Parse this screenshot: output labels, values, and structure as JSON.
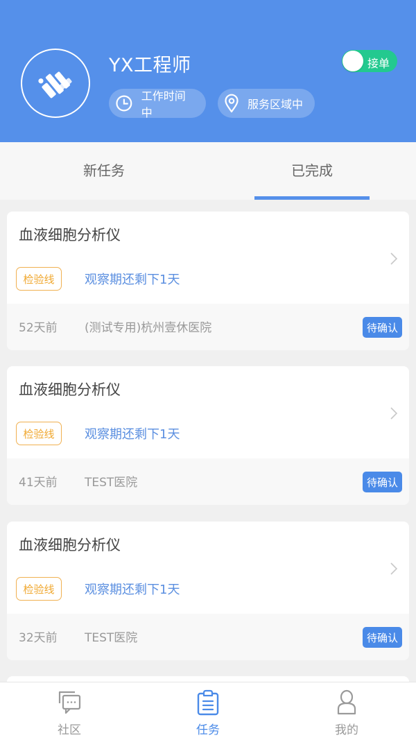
{
  "header": {
    "username": "YX工程师",
    "chips": [
      {
        "icon": "clock-icon",
        "label": "工作时间中"
      },
      {
        "icon": "location-pin-icon",
        "label": "服务区域中"
      }
    ],
    "toggle": {
      "label": "接单",
      "on": true
    }
  },
  "tabs": [
    {
      "label": "新任务",
      "active": false
    },
    {
      "label": "已完成",
      "active": true
    }
  ],
  "cards": [
    {
      "title": "血液细胞分析仪",
      "tag": "检验线",
      "observation": "观察期还剩下1天",
      "ago": "52天前",
      "hospital": "(测试专用)杭州壹休医院",
      "status": "待确认"
    },
    {
      "title": "血液细胞分析仪",
      "tag": "检验线",
      "observation": "观察期还剩下1天",
      "ago": "41天前",
      "hospital": "TEST医院",
      "status": "待确认"
    },
    {
      "title": "血液细胞分析仪",
      "tag": "检验线",
      "observation": "观察期还剩下1天",
      "ago": "32天前",
      "hospital": "TEST医院",
      "status": "待确认"
    }
  ],
  "tabbar": [
    {
      "icon": "chat-bubbles-icon",
      "label": "社区",
      "active": false
    },
    {
      "icon": "clipboard-icon",
      "label": "任务",
      "active": true
    },
    {
      "icon": "person-icon",
      "label": "我的",
      "active": false
    }
  ],
  "colors": {
    "primary": "#5590ea",
    "toggle_on": "#23c98f",
    "tag_orange": "#f0a830",
    "status_blue": "#4a8ae8"
  }
}
